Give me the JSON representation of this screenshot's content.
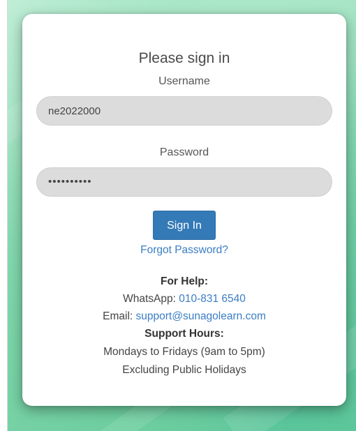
{
  "login": {
    "title": "Please sign in",
    "username_label": "Username",
    "username_value": "ne2022000",
    "password_label": "Password",
    "password_value": "••••••••••",
    "sign_in_label": "Sign In",
    "forgot_label": "Forgot Password?"
  },
  "help": {
    "heading": "For Help:",
    "whatsapp_prefix": "WhatsApp: ",
    "whatsapp_number": "010-831 6540",
    "email_prefix": "Email: ",
    "email_address": "support@sunagolearn.com",
    "hours_heading": "Support Hours:",
    "hours_line1": "Mondays to Fridays (9am to 5pm)",
    "hours_line2": "Excluding Public Holidays"
  },
  "colors": {
    "accent": "#337ab7",
    "link": "#3a7dc4",
    "background": "#8fdcb6"
  }
}
